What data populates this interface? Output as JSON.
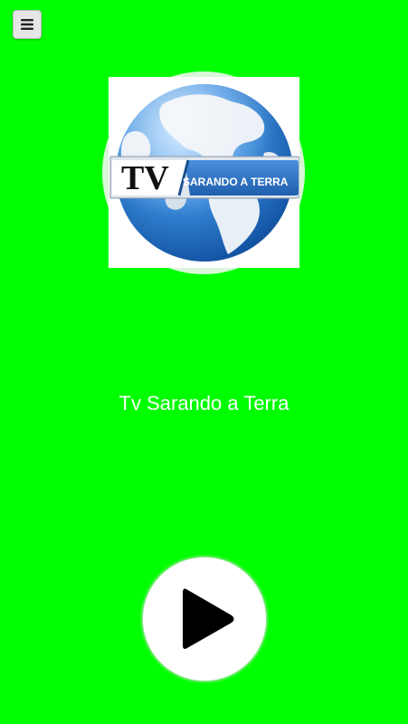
{
  "app": {
    "background_color": "#00ff00"
  },
  "menu": {
    "icon": "hamburger-menu-icon"
  },
  "logo": {
    "tv_text": "TV",
    "name_text": "SARANDO A TERRA",
    "ring_color": "#d8f7d8",
    "ocean_color": "#2a7fd4",
    "land_color": "#e8eef5",
    "banner_color": "#2b74c8"
  },
  "station": {
    "title": "Tv Sarando a Terra"
  },
  "player": {
    "play_icon": "play-icon"
  }
}
